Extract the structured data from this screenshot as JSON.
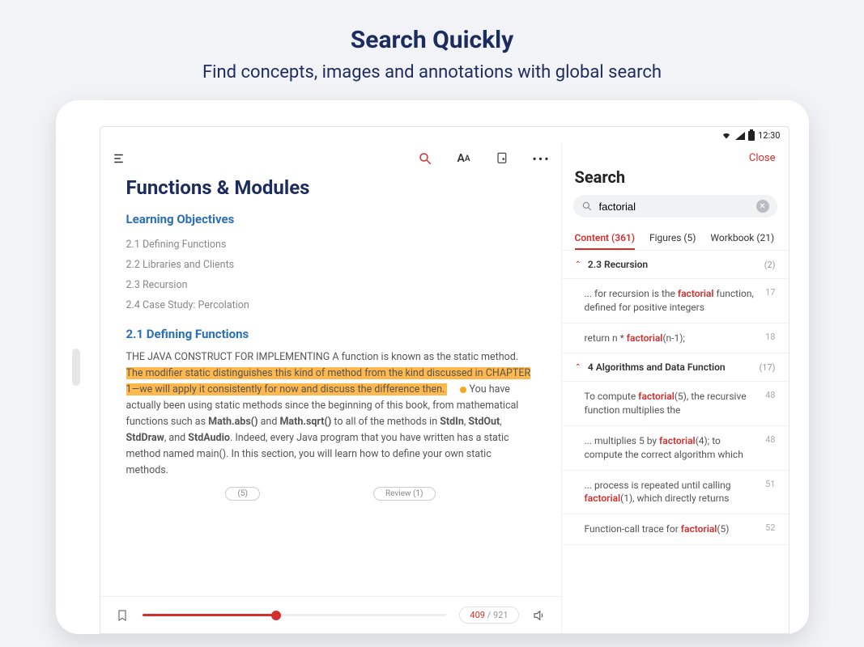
{
  "promo": {
    "title": "Search Quickly",
    "subtitle": "Find concepts, images and annotations with global search"
  },
  "status": {
    "time": "12:30"
  },
  "reader": {
    "title": "Functions & Modules",
    "objectives_heading": "Learning Objectives",
    "toc": [
      "2.1 Defining Functions",
      "2.2 Libraries and Clients",
      "2.3 Recursion",
      "2.4 Case Study: Percolation"
    ],
    "section_heading": "2.1 Defining Functions",
    "body_pre": "THE JAVA CONSTRUCT FOR IMPLEMENTING A function is known as the static method. ",
    "body_hl": "The modifier static distinguishes this kind of method from the kind discussed in CHAPTER 1—we will apply it consistently for now and discuss the difference then. ",
    "body_post1": "You have actually been using static methods since the beginning of this book, from mathematical functions such as ",
    "body_bold1": "Math.abs()",
    "body_mid1": " and ",
    "body_bold2": "Math.sqrt()",
    "body_mid2": " to all of the methods in ",
    "body_bold3": "StdIn",
    "body_mid3": ", ",
    "body_bold4": "StdOut",
    "body_mid4": ", ",
    "body_bold5": "StdDraw",
    "body_mid5": ", and ",
    "body_bold6": "StdAudio",
    "body_post2": ". Indeed, every Java program that you have written has a static method named main(). In this section, you will learn how to define your own static methods.",
    "pill_left": "(5)",
    "pill_right": "Review (1)",
    "page_current": "409",
    "page_sep": " / ",
    "page_total": "921"
  },
  "search": {
    "close_label": "Close",
    "title": "Search",
    "query": "factorial",
    "tabs": [
      {
        "label": "Content (361)",
        "active": true
      },
      {
        "label": "Figures (5)",
        "active": false
      },
      {
        "label": "Workbook (21)",
        "active": false
      }
    ],
    "sections": [
      {
        "title": "2.3 Recursion",
        "count": "(2)"
      }
    ],
    "results1": [
      {
        "pre": "... for recursion is the ",
        "kw": "factorial",
        "post": " function, defined for positive integers",
        "hit": "17"
      },
      {
        "pre": "return n * ",
        "kw": "factorial",
        "post": "(n-1);",
        "hit": "18"
      }
    ],
    "section2": {
      "title": "4 Algorithms and Data Function",
      "count": "(17)"
    },
    "results2": [
      {
        "pre": "To compute ",
        "kw": "factorial",
        "post": "(5), the recursive function multiplies the",
        "hit": "48"
      },
      {
        "pre": "... multiplies 5 by ",
        "kw": "factorial",
        "post": "(4); to compute the correct algorithm which",
        "hit": "48"
      },
      {
        "pre": "... process is repeated until calling ",
        "kw": "factorial",
        "post": "(1), which directly returns",
        "hit": "51"
      },
      {
        "pre": "Function-call trace for ",
        "kw": "factorial",
        "post": "(5)",
        "hit": "52"
      }
    ]
  }
}
